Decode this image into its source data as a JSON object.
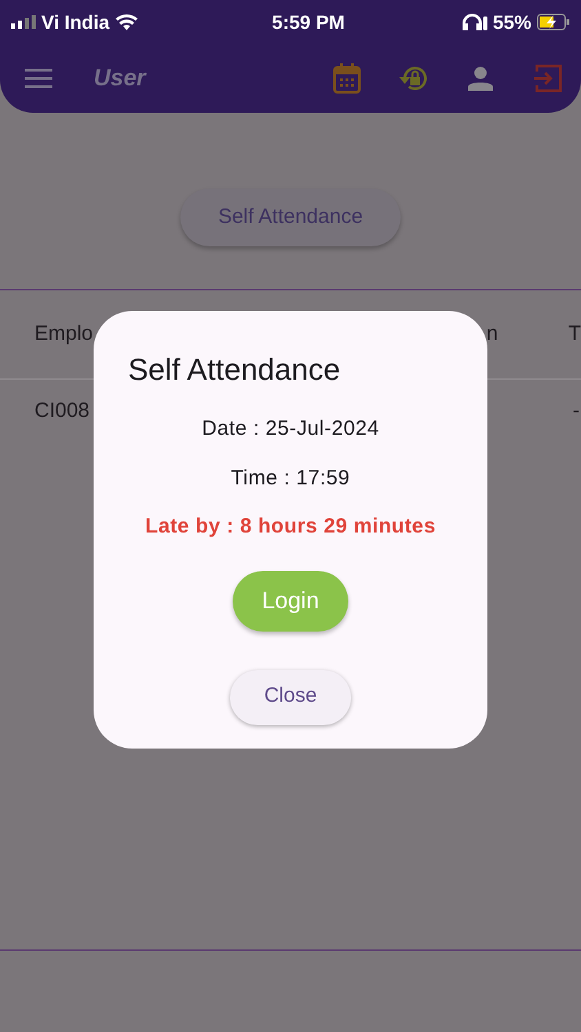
{
  "status_bar": {
    "carrier": "Vi India",
    "time": "5:59 PM",
    "battery": "55%"
  },
  "app_bar": {
    "title": "User"
  },
  "self_attendance_button": "Self Attendance",
  "table": {
    "columns": [
      "Emplo",
      "n",
      "T"
    ],
    "rows": [
      {
        "column_1": "CI008",
        "column_3": "-"
      }
    ]
  },
  "dialog": {
    "title": "Self Attendance",
    "date": "Date : 25-Jul-2024",
    "time": "Time : 17:59",
    "late_message": "Late by : 8 hours 29 minutes",
    "buttons": [
      {
        "kind": "primary",
        "label": "Login"
      },
      {
        "kind": "secondary",
        "label": "Close"
      }
    ]
  }
}
